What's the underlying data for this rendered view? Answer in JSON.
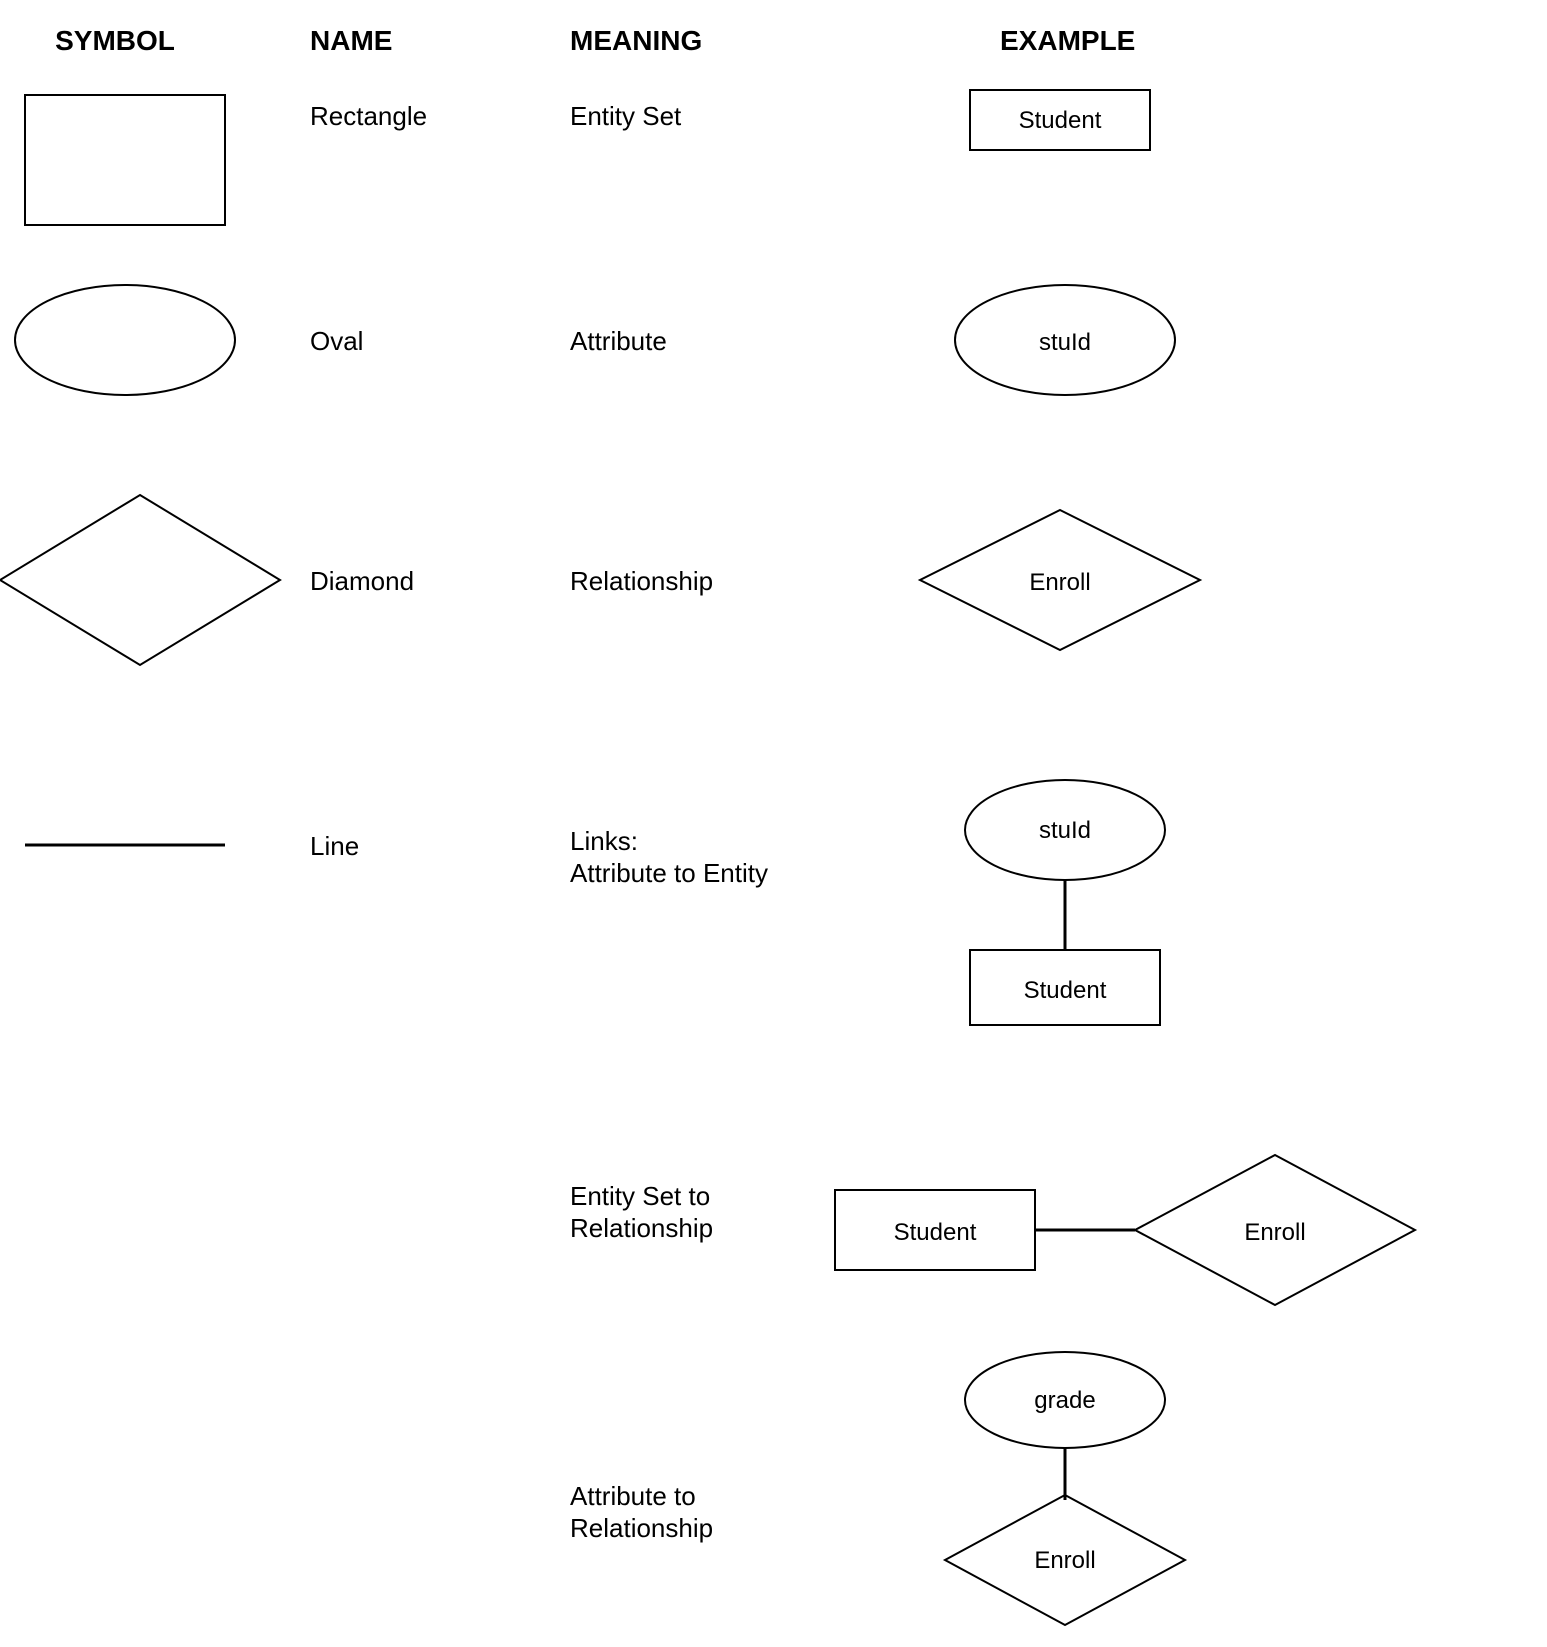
{
  "headers": {
    "symbol": "SYMBOL",
    "name": "NAME",
    "meaning": "MEANING",
    "example": "EXAMPLE"
  },
  "rows": [
    {
      "name": "Rectangle",
      "meaning": "Entity Set",
      "example_label": "Student"
    },
    {
      "name": "Oval",
      "meaning": "Attribute",
      "example_label": "stuId"
    },
    {
      "name": "Diamond",
      "meaning": "Relationship",
      "example_label": "Enroll"
    },
    {
      "name": "Line",
      "meaning": "Links:\nAttribute to Entity",
      "example_top": "stuId",
      "example_bottom": "Student"
    },
    {
      "meaning": "Entity Set to\nRelationship",
      "example_left": "Student",
      "example_right": "Enroll"
    },
    {
      "meaning": "Attribute to\nRelationship",
      "example_top": "grade",
      "example_bottom": "Enroll"
    }
  ]
}
